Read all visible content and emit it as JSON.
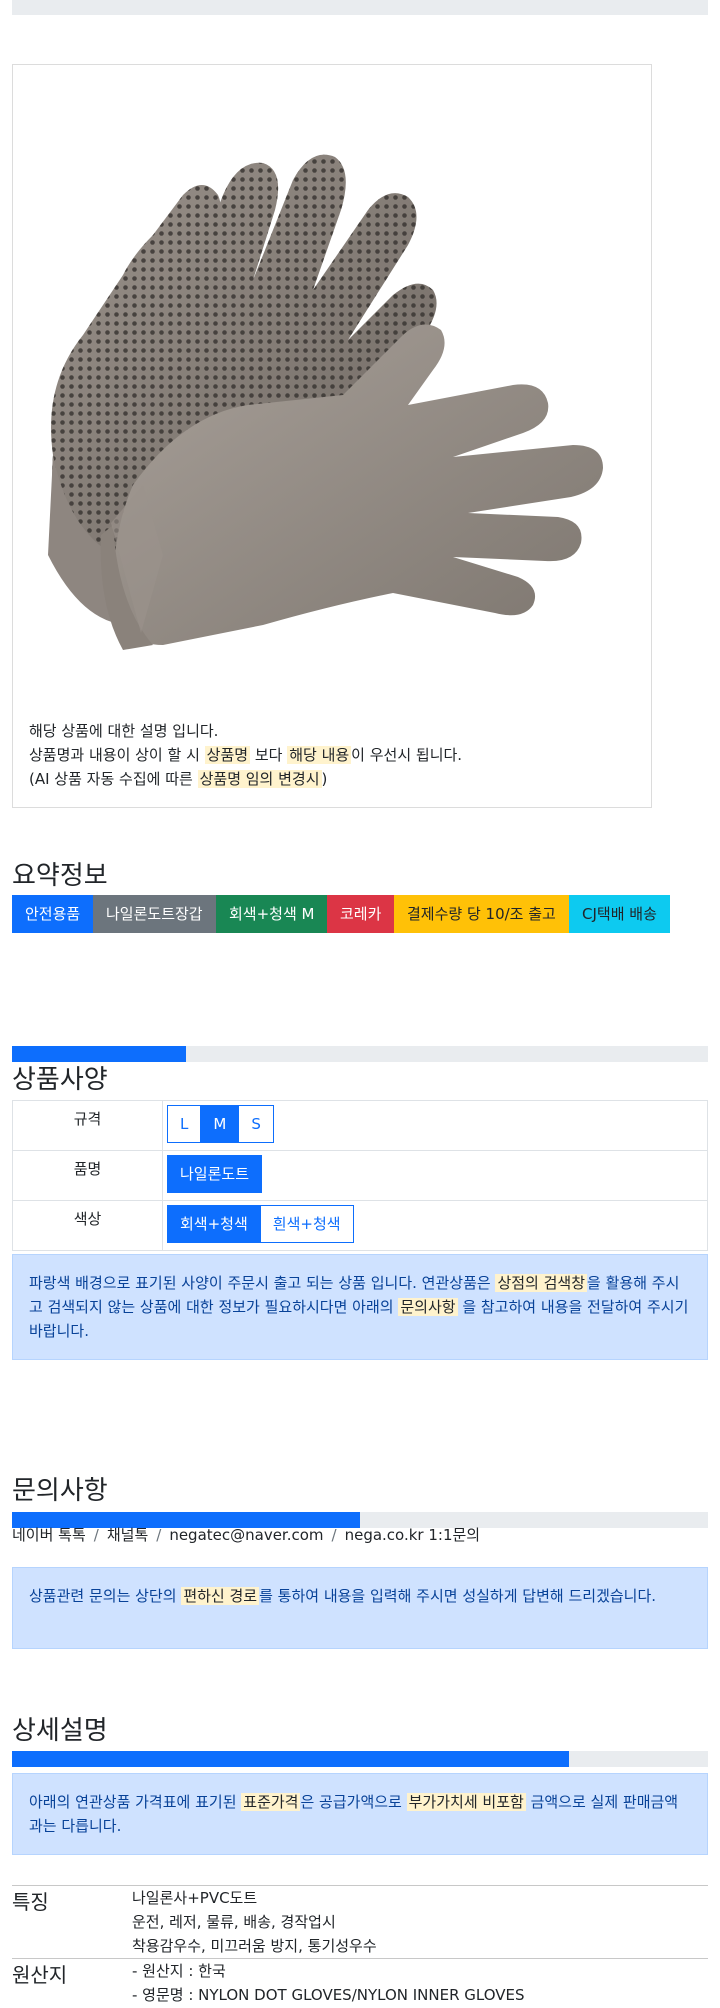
{
  "product": {
    "caption_line1": "해당 상품에 대한 설명 입니다.",
    "caption_line2_pre": "상품명과 내용이 상이 할 시 ",
    "caption_line2_mark1": "상품명",
    "caption_line2_mid": " 보다 ",
    "caption_line2_mark2": "해당 내용",
    "caption_line2_post": "이 우선시 됩니다.",
    "caption_line3_pre": "(AI 상품 자동 수집에 따른 ",
    "caption_line3_mark": "상품명 임의 변경시",
    "caption_line3_post": ")"
  },
  "summary": {
    "title": "요약정보",
    "tags": [
      {
        "label": "안전용품",
        "color": "#0d6efd",
        "text_color": "#ffffff"
      },
      {
        "label": "나일론도트장갑",
        "color": "#6c757d",
        "text_color": "#ffffff"
      },
      {
        "label": "회색+청색 M",
        "color": "#198754",
        "text_color": "#ffffff"
      },
      {
        "label": "코레카",
        "color": "#dc3545",
        "text_color": "#ffffff"
      },
      {
        "label": "결제수량 당 10/조 출고",
        "color": "#ffc107",
        "text_color": "#212529"
      },
      {
        "label": "CJ택배 배송",
        "color": "#0dcaf0",
        "text_color": "#212529"
      }
    ]
  },
  "specs": {
    "title": "상품사양",
    "progress_percent": 25,
    "rows": [
      {
        "label": "규격",
        "options": [
          {
            "label": "L",
            "active": false
          },
          {
            "label": "M",
            "active": true
          },
          {
            "label": "S",
            "active": false
          }
        ]
      },
      {
        "label": "품명",
        "options": [
          {
            "label": "나일론도트",
            "active": true
          }
        ]
      },
      {
        "label": "색상",
        "options": [
          {
            "label": "회색+청색",
            "active": true
          },
          {
            "label": "흰색+청색",
            "active": false
          }
        ]
      }
    ],
    "note_pre": "파랑색 배경으로 표기된 사양이 주문시 출고 되는 상품 입니다. 연관상품은 ",
    "note_mark1": "상점의 검색창",
    "note_mid": "을 활용해 주시고 검색되지 않는 상품에 대한 정보가 필요하시다면 아래의 ",
    "note_mark2": "문의사항",
    "note_post": " 을 참고하여 내용을 전달하여 주시기 바랍니다."
  },
  "inquiry": {
    "title": "문의사항",
    "progress_percent": 50,
    "channels": [
      "네이버 톡톡",
      "채널톡",
      "negatec@naver.com",
      "nega.co.kr 1:1문의"
    ],
    "separator": "/",
    "note_pre": "상품관련 문의는 상단의 ",
    "note_mark": "편하신 경로",
    "note_post": "를 통하여 내용을 입력해 주시면 성실하게 답변해 드리겠습니다."
  },
  "detail": {
    "title": "상세설명",
    "progress_percent": 80,
    "note_pre": "아래의 연관상품 가격표에 표기된 ",
    "note_mark1": "표준가격",
    "note_mid": "은 공급가액으로 ",
    "note_mark2": "부가가치세 비포함",
    "note_post": " 금액으로 실제 판매금액과는 다릅니다.",
    "features": [
      {
        "key": "특징",
        "values": [
          "나일론사+PVC도트",
          "운전, 레저, 물류, 배송, 경작업시",
          "착용감우수, 미끄러움 방지, 통기성우수"
        ]
      },
      {
        "key": "원산지",
        "values": [
          "- 원산지 : 한국",
          "- 영문명 : NYLON DOT GLOVES/NYLON INNER GLOVES"
        ]
      }
    ]
  }
}
